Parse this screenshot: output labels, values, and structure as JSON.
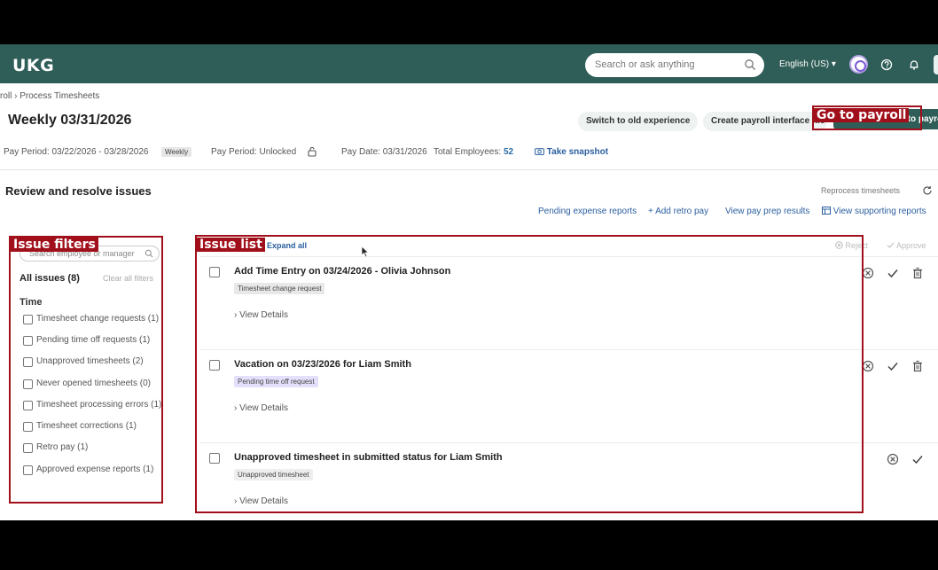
{
  "app": {
    "logo": "UKG"
  },
  "header": {
    "search_placeholder": "Search or ask anything",
    "language": "English (US) ▾",
    "icons": [
      "search-icon",
      "avatar",
      "help-icon",
      "bell-icon"
    ]
  },
  "breadcrumb": {
    "text": "roll  ›  Process Timesheets"
  },
  "page": {
    "title": "Weekly 03/31/2026",
    "buttons": {
      "old_experience": "Switch to old experience",
      "payroll_interface": "Create payroll interface file",
      "go_to_payroll": "Go to payroll processing"
    }
  },
  "meta": {
    "pay_period": "Pay Period: 03/22/2026 - 03/28/2026",
    "frequency": "Weekly",
    "pay_status": "Pay Period: Unlocked",
    "pay_date": "Pay Date: 03/31/2026",
    "total_label": "Total Employees:",
    "total_value": "52",
    "snapshot": "Take snapshot"
  },
  "review": {
    "title": "Review and resolve issues",
    "reprocess": "Reprocess timesheets",
    "links": {
      "pending_expense": "Pending expense reports",
      "add_retro": "Add retro pay",
      "pay_prep": "View pay prep results",
      "supporting": "View supporting reports"
    }
  },
  "filters": {
    "search_placeholder": "Search employee or manager",
    "all_issues": "All issues (8)",
    "clear_all": "Clear all filters",
    "group": "Time",
    "items": [
      "Timesheet change requests (1)",
      "Pending time off requests (1)",
      "Unapproved timesheets (2)",
      "Never opened timesheets (0)",
      "Timesheet processing errors (1)",
      "Timesheet corrections (1)",
      "Retro pay (1)",
      "Approved expense reports (1)"
    ]
  },
  "issue_list": {
    "expand_all": "Expand all",
    "reject": "Reject",
    "approve": "Approve",
    "view_details": "View Details",
    "issues": [
      {
        "title": "Add Time Entry on 03/24/2026 - Olivia Johnson",
        "tag": "Timesheet change request",
        "tag_color": "#e8e8e8"
      },
      {
        "title": "Vacation on 03/23/2026 for Liam Smith",
        "tag": "Pending time off request",
        "tag_color": "#e4e0fb"
      },
      {
        "title": "Unapproved timesheet in submitted status for Liam Smith",
        "tag": "Unapproved timesheet",
        "tag_color": "#eeeeee"
      }
    ]
  },
  "annotations": {
    "go_to_payroll": "Go to payroll",
    "issue_filters": "Issue filters",
    "issue_list": "Issue list"
  },
  "colors": {
    "header": "#2f5d57",
    "link": "#2b5fa0",
    "annotation": "#a00f1a"
  }
}
